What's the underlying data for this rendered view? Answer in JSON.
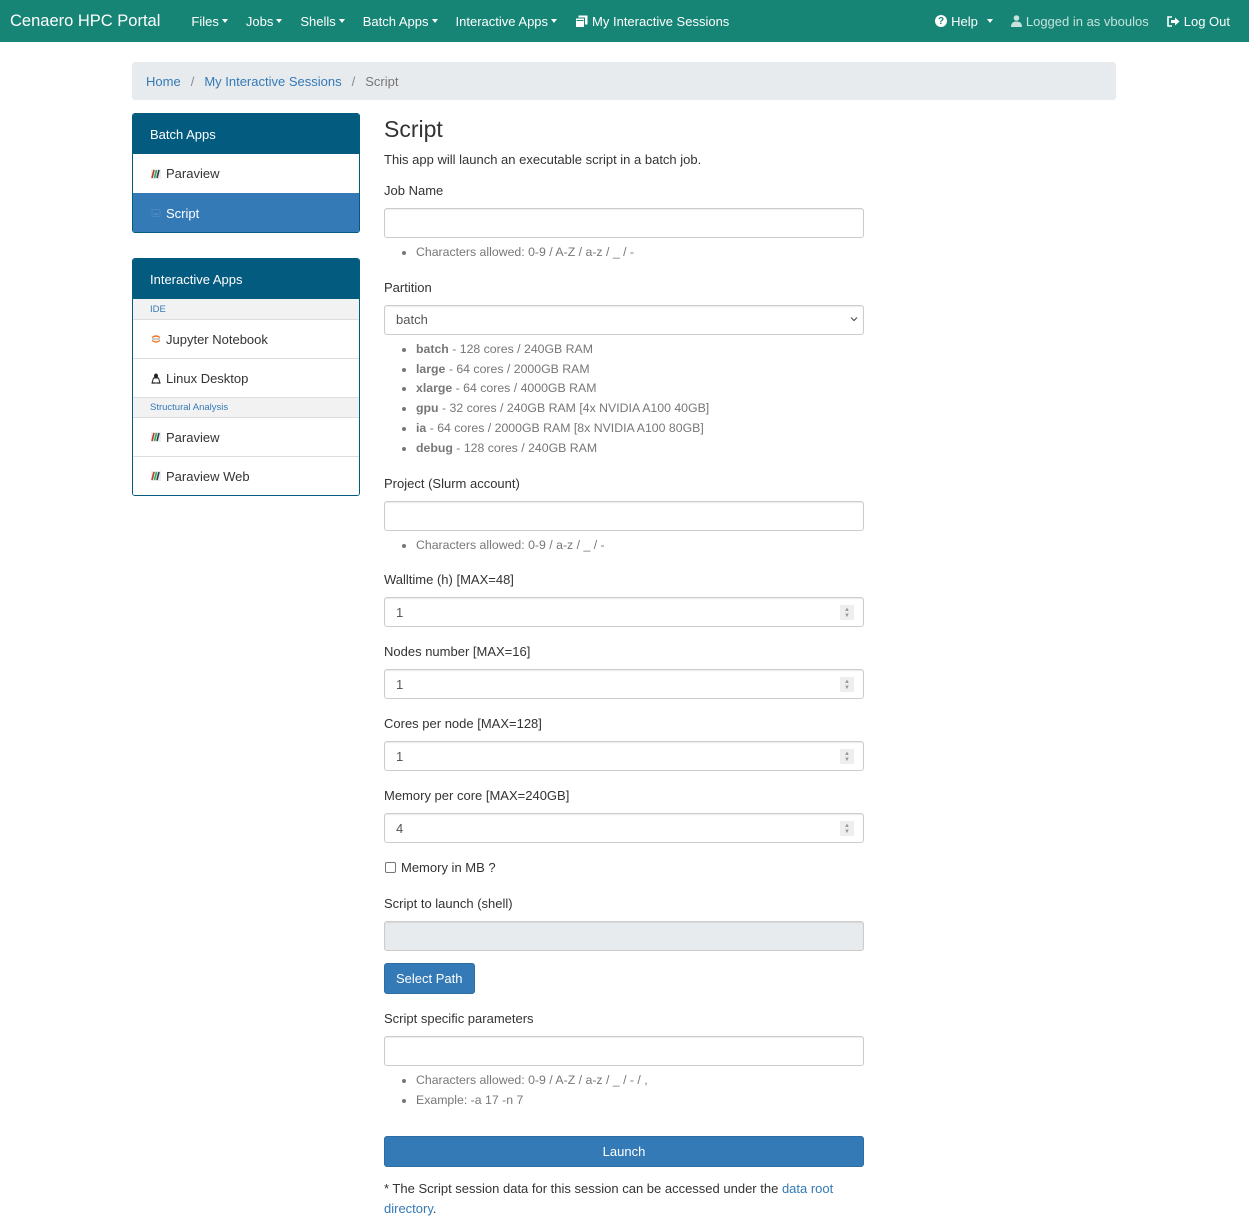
{
  "navbar": {
    "brand": "Cenaero HPC Portal",
    "menus": [
      {
        "label": "Files",
        "dropdown": true
      },
      {
        "label": "Jobs",
        "dropdown": true
      },
      {
        "label": "Shells",
        "dropdown": true
      },
      {
        "label": "Batch Apps",
        "dropdown": true
      },
      {
        "label": "Interactive Apps",
        "dropdown": true
      }
    ],
    "sessions_link": {
      "label": "My Interactive Sessions",
      "icon": "clone-icon"
    },
    "help": {
      "label": "Help",
      "icon": "question-circle-icon"
    },
    "user": {
      "label": "Logged in as vboulos",
      "icon": "user-icon"
    },
    "logout": {
      "label": "Log Out",
      "icon": "sign-out-icon"
    },
    "colors": {
      "background": "#168576"
    }
  },
  "breadcrumb": {
    "items": [
      {
        "label": "Home",
        "link": true
      },
      {
        "label": "My Interactive Sessions",
        "link": true
      },
      {
        "label": "Script",
        "link": false
      }
    ],
    "separator": "/"
  },
  "sidebar": {
    "batch_apps": {
      "heading": "Batch Apps",
      "items": [
        {
          "label": "Paraview",
          "icon": "paraview-icon",
          "active": false
        },
        {
          "label": "Script",
          "icon": "script-icon",
          "active": true
        }
      ]
    },
    "interactive_apps": {
      "heading": "Interactive Apps",
      "groups": [
        {
          "header": "IDE",
          "items": [
            {
              "label": "Jupyter Notebook",
              "icon": "jupyter-icon"
            },
            {
              "label": "Linux Desktop",
              "icon": "linux-icon"
            }
          ]
        },
        {
          "header": "Structural Analysis",
          "items": [
            {
              "label": "Paraview",
              "icon": "paraview-icon"
            },
            {
              "label": "Paraview Web",
              "icon": "paraview-icon"
            }
          ]
        }
      ]
    },
    "colors": {
      "heading": "#045b80",
      "active": "#337ab7"
    }
  },
  "form": {
    "title": "Script",
    "description": "This app will launch an executable script in a batch job.",
    "job_name": {
      "label": "Job Name",
      "value": "",
      "help": [
        "Characters allowed: 0-9 / A-Z / a-z / _ / -"
      ]
    },
    "partition": {
      "label": "Partition",
      "selected": "batch",
      "help": [
        {
          "name": "batch",
          "desc": " - 128 cores / 240GB RAM"
        },
        {
          "name": "large",
          "desc": " - 64 cores / 2000GB RAM"
        },
        {
          "name": "xlarge",
          "desc": " - 64 cores / 4000GB RAM"
        },
        {
          "name": "gpu",
          "desc": " - 32 cores / 240GB RAM [4x NVIDIA A100 40GB]"
        },
        {
          "name": "ia",
          "desc": " - 64 cores / 2000GB RAM [8x NVIDIA A100 80GB]"
        },
        {
          "name": "debug",
          "desc": " - 128 cores / 240GB RAM"
        }
      ]
    },
    "project": {
      "label": "Project (Slurm account)",
      "value": "",
      "help": [
        "Characters allowed: 0-9 / a-z / _ / -"
      ]
    },
    "walltime": {
      "label": "Walltime (h) [MAX=48]",
      "value": "1"
    },
    "nodes": {
      "label": "Nodes number [MAX=16]",
      "value": "1"
    },
    "cores": {
      "label": "Cores per node [MAX=128]",
      "value": "1"
    },
    "memory": {
      "label": "Memory per core [MAX=240GB]",
      "value": "4"
    },
    "memory_mb": {
      "label": "Memory in MB ?",
      "checked": false
    },
    "script_path": {
      "label": "Script to launch (shell)",
      "value": ""
    },
    "select_path_button": "Select Path",
    "script_params": {
      "label": "Script specific parameters",
      "value": "",
      "help": [
        "Characters allowed: 0-9 / A-Z / a-z / _ / - / ,",
        "Example: -a 17 -n 7"
      ]
    },
    "launch_button": "Launch",
    "footnote": {
      "text": "* The Script session data for this session can be accessed under the ",
      "link": "data root directory",
      "suffix": "."
    }
  }
}
